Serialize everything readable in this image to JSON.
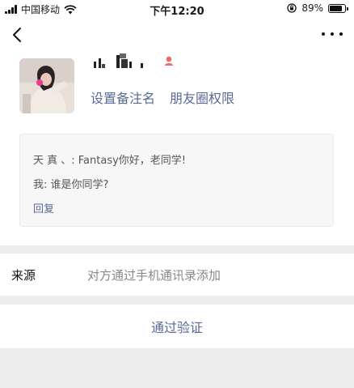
{
  "status_bar": {
    "carrier": "中国移动",
    "time": "下午12:20",
    "battery": "89%",
    "battery_level": 0.89
  },
  "nav": {
    "back_icon": "chevron-left-icon",
    "more_icon": "more-dots-icon"
  },
  "profile": {
    "name_icon": "obscured-nickname",
    "gender_icon": "female-gender-icon",
    "set_remark": "设置备注名",
    "moments_permission": "朋友圈权限"
  },
  "messages": {
    "greeting": "天 真 、: Fantasy你好，老同学!",
    "my_reply": "我: 谁是你同学?",
    "reply_link": "回复"
  },
  "source": {
    "label": "来源",
    "value": "对方通过手机通讯录添加"
  },
  "verify_button": "通过验证",
  "colors": {
    "link": "#576b95",
    "separator": "#ededed",
    "card_bg": "#f7f7f7"
  }
}
